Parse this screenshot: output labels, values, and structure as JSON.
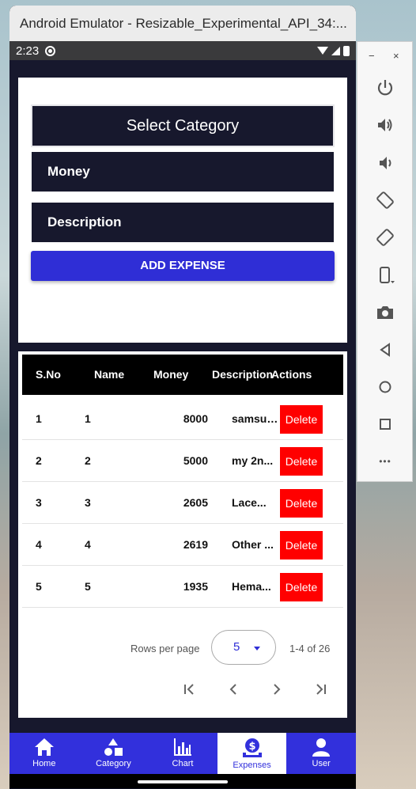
{
  "window": {
    "title": "Android Emulator - Resizable_Experimental_API_34:..."
  },
  "statusbar": {
    "time": "2:23"
  },
  "form": {
    "select_category": "Select Category",
    "money_placeholder": "Money",
    "description_placeholder": "Description",
    "add_button": "ADD EXPENSE"
  },
  "table": {
    "headers": [
      "S.No",
      "Name",
      "Money",
      "Description",
      "Actions"
    ],
    "rows": [
      {
        "sno": "1",
        "name": "1",
        "money": "8000",
        "description": "samsun...",
        "action": "Delete"
      },
      {
        "sno": "2",
        "name": "2",
        "money": "5000",
        "description": "my 2n...",
        "action": "Delete"
      },
      {
        "sno": "3",
        "name": "3",
        "money": "2605",
        "description": "Lace...",
        "action": "Delete"
      },
      {
        "sno": "4",
        "name": "4",
        "money": "2619",
        "description": "Other ...",
        "action": "Delete"
      },
      {
        "sno": "5",
        "name": "5",
        "money": "1935",
        "description": "Hema...",
        "action": "Delete"
      }
    ],
    "rows_per_page_label": "Rows per page",
    "rows_per_page_value": "5",
    "range_label": "1-4 of 26"
  },
  "nav": {
    "items": [
      {
        "label": "Home",
        "icon": "home-icon"
      },
      {
        "label": "Category",
        "icon": "category-icon"
      },
      {
        "label": "Chart",
        "icon": "chart-icon"
      },
      {
        "label": "Expenses",
        "icon": "expenses-icon",
        "active": true
      },
      {
        "label": "User",
        "icon": "user-icon"
      }
    ]
  },
  "toolbar": {
    "minimize": "−",
    "close": "×",
    "buttons": [
      "power-icon",
      "volume-up-icon",
      "volume-down-icon",
      "rotate-left-icon",
      "rotate-right-icon",
      "fold-icon",
      "camera-icon",
      "back-icon",
      "home-circle-icon",
      "overview-icon",
      "more-icon"
    ],
    "more": "•••"
  },
  "colors": {
    "accent": "#3230dc",
    "dark": "#17182d",
    "delete": "#ff0000"
  }
}
